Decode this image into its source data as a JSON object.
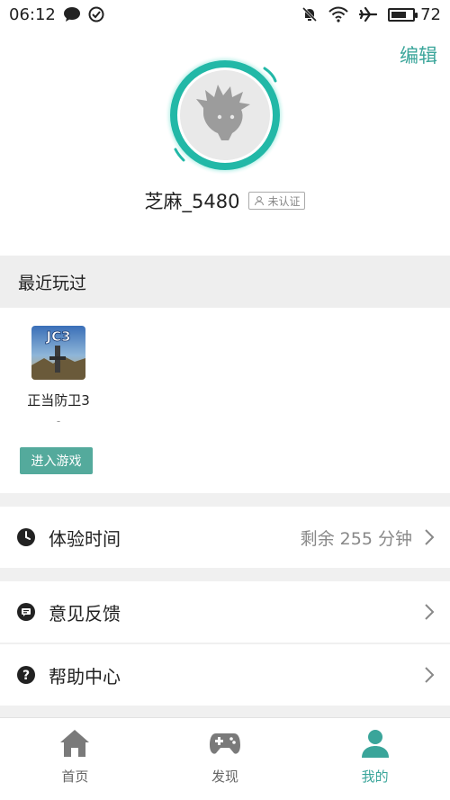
{
  "status_bar": {
    "time": "06:12",
    "battery_level": "72"
  },
  "profile": {
    "edit_label": "编辑",
    "username": "芝麻_5480",
    "verify_badge": "未认证"
  },
  "recent": {
    "section_title": "最近玩过",
    "games": [
      {
        "thumb_text": "JC3",
        "name": "正当防卫3",
        "sub": "-"
      }
    ],
    "enter_button": "进入游戏"
  },
  "rows": {
    "experience_time": {
      "label": "体验时间",
      "value": "剩余 255 分钟"
    },
    "feedback": {
      "label": "意见反馈"
    },
    "help": {
      "label": "帮助中心"
    }
  },
  "bottom_nav": {
    "items": [
      {
        "label": "首页",
        "icon": "home-icon"
      },
      {
        "label": "发现",
        "icon": "gamepad-icon"
      },
      {
        "label": "我的",
        "icon": "person-icon"
      }
    ],
    "active_index": 2
  },
  "colors": {
    "accent": "#3aa59a",
    "button": "#54aa9c",
    "section_bg": "#eeeeee"
  }
}
